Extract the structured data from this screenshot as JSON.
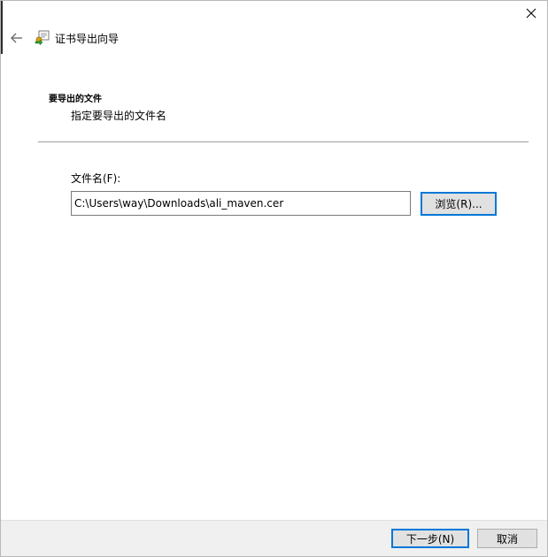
{
  "window": {
    "title": "证书导出向导",
    "close_icon": "close-icon",
    "back_icon": "back-arrow-icon",
    "wizard_icon": "certificate-export-icon"
  },
  "header": {
    "title": "要导出的文件",
    "subtitle": "指定要导出的文件名"
  },
  "form": {
    "file_label": "文件名(F):",
    "file_value": "C:\\Users\\way\\Downloads\\ali_maven.cer",
    "browse_label": "浏览(R)..."
  },
  "footer": {
    "next_label": "下一步(N)",
    "cancel_label": "取消"
  },
  "colors": {
    "accent": "#0078d7",
    "footer_bg": "#f0f0f0",
    "button_bg": "#e1e1e1"
  }
}
